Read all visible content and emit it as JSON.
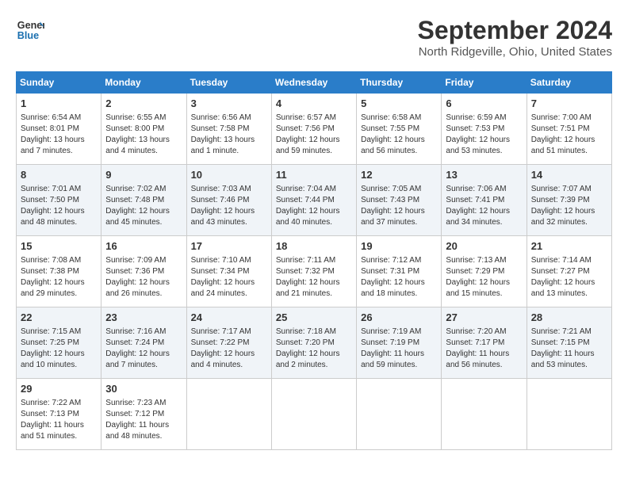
{
  "header": {
    "logo_line1": "General",
    "logo_line2": "Blue",
    "title": "September 2024",
    "location": "North Ridgeville, Ohio, United States"
  },
  "days_of_week": [
    "Sunday",
    "Monday",
    "Tuesday",
    "Wednesday",
    "Thursday",
    "Friday",
    "Saturday"
  ],
  "weeks": [
    [
      {
        "day": 1,
        "lines": [
          "Sunrise: 6:54 AM",
          "Sunset: 8:01 PM",
          "Daylight: 13 hours",
          "and 7 minutes."
        ]
      },
      {
        "day": 2,
        "lines": [
          "Sunrise: 6:55 AM",
          "Sunset: 8:00 PM",
          "Daylight: 13 hours",
          "and 4 minutes."
        ]
      },
      {
        "day": 3,
        "lines": [
          "Sunrise: 6:56 AM",
          "Sunset: 7:58 PM",
          "Daylight: 13 hours",
          "and 1 minute."
        ]
      },
      {
        "day": 4,
        "lines": [
          "Sunrise: 6:57 AM",
          "Sunset: 7:56 PM",
          "Daylight: 12 hours",
          "and 59 minutes."
        ]
      },
      {
        "day": 5,
        "lines": [
          "Sunrise: 6:58 AM",
          "Sunset: 7:55 PM",
          "Daylight: 12 hours",
          "and 56 minutes."
        ]
      },
      {
        "day": 6,
        "lines": [
          "Sunrise: 6:59 AM",
          "Sunset: 7:53 PM",
          "Daylight: 12 hours",
          "and 53 minutes."
        ]
      },
      {
        "day": 7,
        "lines": [
          "Sunrise: 7:00 AM",
          "Sunset: 7:51 PM",
          "Daylight: 12 hours",
          "and 51 minutes."
        ]
      }
    ],
    [
      {
        "day": 8,
        "lines": [
          "Sunrise: 7:01 AM",
          "Sunset: 7:50 PM",
          "Daylight: 12 hours",
          "and 48 minutes."
        ]
      },
      {
        "day": 9,
        "lines": [
          "Sunrise: 7:02 AM",
          "Sunset: 7:48 PM",
          "Daylight: 12 hours",
          "and 45 minutes."
        ]
      },
      {
        "day": 10,
        "lines": [
          "Sunrise: 7:03 AM",
          "Sunset: 7:46 PM",
          "Daylight: 12 hours",
          "and 43 minutes."
        ]
      },
      {
        "day": 11,
        "lines": [
          "Sunrise: 7:04 AM",
          "Sunset: 7:44 PM",
          "Daylight: 12 hours",
          "and 40 minutes."
        ]
      },
      {
        "day": 12,
        "lines": [
          "Sunrise: 7:05 AM",
          "Sunset: 7:43 PM",
          "Daylight: 12 hours",
          "and 37 minutes."
        ]
      },
      {
        "day": 13,
        "lines": [
          "Sunrise: 7:06 AM",
          "Sunset: 7:41 PM",
          "Daylight: 12 hours",
          "and 34 minutes."
        ]
      },
      {
        "day": 14,
        "lines": [
          "Sunrise: 7:07 AM",
          "Sunset: 7:39 PM",
          "Daylight: 12 hours",
          "and 32 minutes."
        ]
      }
    ],
    [
      {
        "day": 15,
        "lines": [
          "Sunrise: 7:08 AM",
          "Sunset: 7:38 PM",
          "Daylight: 12 hours",
          "and 29 minutes."
        ]
      },
      {
        "day": 16,
        "lines": [
          "Sunrise: 7:09 AM",
          "Sunset: 7:36 PM",
          "Daylight: 12 hours",
          "and 26 minutes."
        ]
      },
      {
        "day": 17,
        "lines": [
          "Sunrise: 7:10 AM",
          "Sunset: 7:34 PM",
          "Daylight: 12 hours",
          "and 24 minutes."
        ]
      },
      {
        "day": 18,
        "lines": [
          "Sunrise: 7:11 AM",
          "Sunset: 7:32 PM",
          "Daylight: 12 hours",
          "and 21 minutes."
        ]
      },
      {
        "day": 19,
        "lines": [
          "Sunrise: 7:12 AM",
          "Sunset: 7:31 PM",
          "Daylight: 12 hours",
          "and 18 minutes."
        ]
      },
      {
        "day": 20,
        "lines": [
          "Sunrise: 7:13 AM",
          "Sunset: 7:29 PM",
          "Daylight: 12 hours",
          "and 15 minutes."
        ]
      },
      {
        "day": 21,
        "lines": [
          "Sunrise: 7:14 AM",
          "Sunset: 7:27 PM",
          "Daylight: 12 hours",
          "and 13 minutes."
        ]
      }
    ],
    [
      {
        "day": 22,
        "lines": [
          "Sunrise: 7:15 AM",
          "Sunset: 7:25 PM",
          "Daylight: 12 hours",
          "and 10 minutes."
        ]
      },
      {
        "day": 23,
        "lines": [
          "Sunrise: 7:16 AM",
          "Sunset: 7:24 PM",
          "Daylight: 12 hours",
          "and 7 minutes."
        ]
      },
      {
        "day": 24,
        "lines": [
          "Sunrise: 7:17 AM",
          "Sunset: 7:22 PM",
          "Daylight: 12 hours",
          "and 4 minutes."
        ]
      },
      {
        "day": 25,
        "lines": [
          "Sunrise: 7:18 AM",
          "Sunset: 7:20 PM",
          "Daylight: 12 hours",
          "and 2 minutes."
        ]
      },
      {
        "day": 26,
        "lines": [
          "Sunrise: 7:19 AM",
          "Sunset: 7:19 PM",
          "Daylight: 11 hours",
          "and 59 minutes."
        ]
      },
      {
        "day": 27,
        "lines": [
          "Sunrise: 7:20 AM",
          "Sunset: 7:17 PM",
          "Daylight: 11 hours",
          "and 56 minutes."
        ]
      },
      {
        "day": 28,
        "lines": [
          "Sunrise: 7:21 AM",
          "Sunset: 7:15 PM",
          "Daylight: 11 hours",
          "and 53 minutes."
        ]
      }
    ],
    [
      {
        "day": 29,
        "lines": [
          "Sunrise: 7:22 AM",
          "Sunset: 7:13 PM",
          "Daylight: 11 hours",
          "and 51 minutes."
        ]
      },
      {
        "day": 30,
        "lines": [
          "Sunrise: 7:23 AM",
          "Sunset: 7:12 PM",
          "Daylight: 11 hours",
          "and 48 minutes."
        ]
      },
      null,
      null,
      null,
      null,
      null
    ]
  ]
}
